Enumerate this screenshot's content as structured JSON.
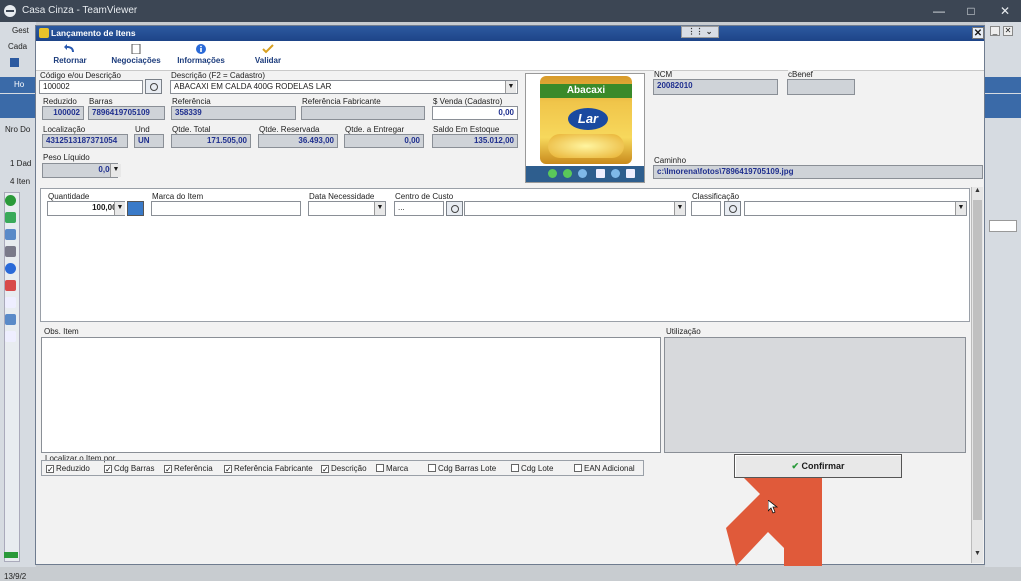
{
  "window": {
    "title": "Casa Cinza - TeamViewer",
    "controls": [
      "—",
      "□",
      "✕"
    ]
  },
  "background": {
    "left_texts": [
      "Gest",
      "Cada",
      "Ho",
      "Nro Do",
      "1 Dad",
      "4 Iten",
      "13/9/2"
    ],
    "right_texts": [
      "_",
      "✕"
    ]
  },
  "dialog": {
    "title": "Lançamento de Itens",
    "close": "✕",
    "tv_panel": "⋮⋮ ⌄"
  },
  "toolbar": [
    {
      "label": "Retornar",
      "icon": "return-arrow-icon"
    },
    {
      "label": "Negociações",
      "icon": "document-icon"
    },
    {
      "label": "Informações",
      "icon": "info-icon"
    },
    {
      "label": "Validar",
      "icon": "validate-icon"
    }
  ],
  "fields": {
    "codigo_label": "Código e/ou Descrição",
    "codigo_value": "100002",
    "descricao_label": "Descrição (F2 = Cadastro)",
    "descricao_value": "ABACAXI EM CALDA 400G RODELAS LAR",
    "reduzido_label": "Reduzido",
    "reduzido_value": "100002",
    "barras_label": "Barras",
    "barras_value": "7896419705109",
    "referencia_label": "Referência",
    "referencia_value": "358339",
    "ref_fabricante_label": "Referência Fabricante",
    "ref_fabricante_value": "",
    "venda_label": "$ Venda (Cadastro)",
    "venda_value": "0,00",
    "localizacao_label": "Localização",
    "localizacao_value": "4312513187371054",
    "und_label": "Und",
    "und_value": "UN",
    "qtde_total_label": "Qtde. Total",
    "qtde_total_value": "171.505,00",
    "qtde_reservada_label": "Qtde. Reservada",
    "qtde_reservada_value": "36.493,00",
    "qtde_entregar_label": "Qtde. a Entregar",
    "qtde_entregar_value": "0,00",
    "saldo_label": "Saldo Em Estoque",
    "saldo_value": "135.012,00",
    "peso_label": "Peso Líquido",
    "peso_value": "0,00",
    "ncm_label": "NCM",
    "ncm_value": "20082010",
    "cbenef_label": "cBenef",
    "cbenef_value": "",
    "caminho_label": "Caminho",
    "caminho_value": "c:\\Imorena\\fotos\\7896419705109.jpg"
  },
  "product_image": {
    "band_text": "Abacaxi",
    "brand": "Lar"
  },
  "item_row": {
    "quantidade_label": "Quantidade",
    "quantidade_value": "100,000",
    "marca_label": "Marca do Item",
    "marca_value": "",
    "data_label": "Data Necessidade",
    "data_value": "",
    "centro_label": "Centro de Custo",
    "centro_value": "...",
    "classificacao_label": "Classificação",
    "classificacao_value": ""
  },
  "obs_label": "Obs. Item",
  "utilizacao_label": "Utilização",
  "localizar": {
    "label": "Localizar o Item por",
    "options": [
      {
        "label": "Reduzido",
        "checked": true
      },
      {
        "label": "Cdg Barras",
        "checked": true
      },
      {
        "label": "Referência",
        "checked": true
      },
      {
        "label": "Referência Fabricante",
        "checked": true
      },
      {
        "label": "Descrição",
        "checked": true
      },
      {
        "label": "Marca",
        "checked": false
      },
      {
        "label": "Cdg Barras Lote",
        "checked": false
      },
      {
        "label": "Cdg Lote",
        "checked": false
      },
      {
        "label": "EAN Adicional",
        "checked": false
      }
    ]
  },
  "confirm_label": "Confirmar",
  "colors": {
    "arrow": "#e05a3a",
    "accent": "#2c5aa0"
  }
}
